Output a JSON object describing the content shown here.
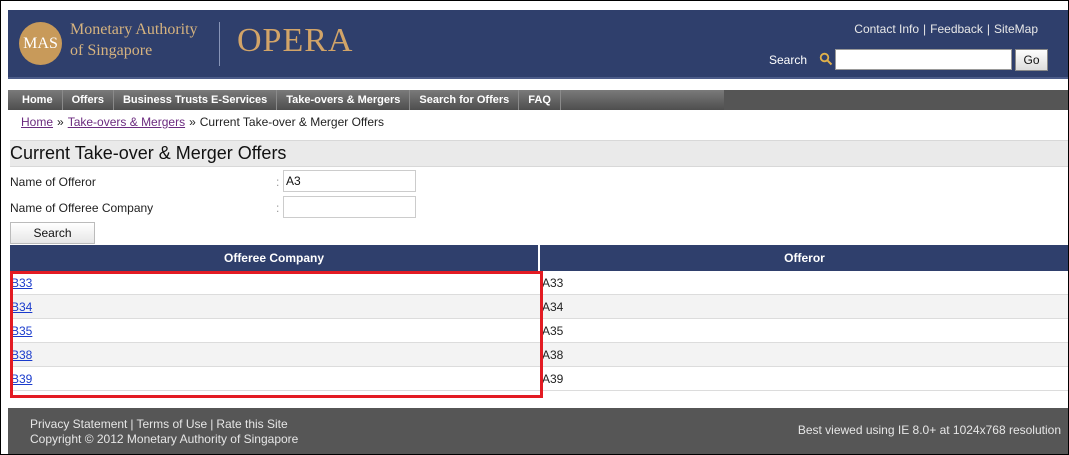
{
  "header": {
    "logo_text": "MAS",
    "org_line1": "Monetary Authority",
    "org_line2": "of Singapore",
    "app_title": "OPERA",
    "links": [
      "Contact Info",
      "Feedback",
      "SiteMap"
    ],
    "search_label": "Search",
    "search_value": "",
    "go_label": "Go"
  },
  "nav": {
    "items": [
      "Home",
      "Offers",
      "Business Trusts E-Services",
      "Take-overs & Mergers",
      "Search for Offers",
      "FAQ"
    ]
  },
  "breadcrumb": {
    "home": "Home",
    "sep": "»",
    "section": "Take-overs & Mergers",
    "current": "Current Take-over & Merger Offers"
  },
  "page_title": "Current Take-over & Merger Offers",
  "form": {
    "offeror_label": "Name of Offeror",
    "offeror_value": "A3",
    "offeree_label": "Name of Offeree Company",
    "offeree_value": "",
    "colon": ":",
    "search_button": "Search"
  },
  "table": {
    "columns": [
      "Offeree Company",
      "Offeror"
    ],
    "rows": [
      [
        "B33",
        "A33"
      ],
      [
        "B34",
        "A34"
      ],
      [
        "B35",
        "A35"
      ],
      [
        "B38",
        "A38"
      ],
      [
        "B39",
        "A39"
      ]
    ]
  },
  "footer": {
    "links": [
      "Privacy Statement",
      "Terms of Use",
      "Rate this Site"
    ],
    "copyright": "Copyright © 2012 Monetary Authority of Singapore",
    "best_viewed": "Best viewed using IE 8.0+ at 1024x768 resolution"
  },
  "colors": {
    "header_bg": "#2f3f6c",
    "title_gold": "#d2a468",
    "highlight_red": "#e31b23",
    "link_blue": "#1a3bcc",
    "visited_purple": "#6b2a7f"
  }
}
